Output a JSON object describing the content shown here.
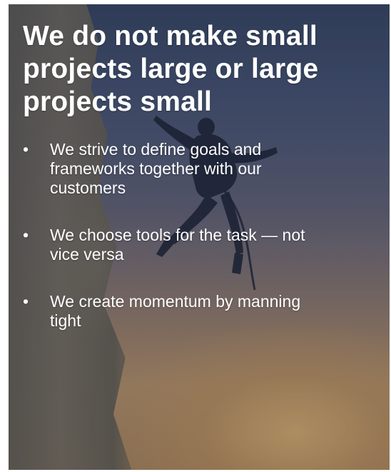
{
  "slide": {
    "headline": "We do not make small projects large or large projects small",
    "bullet_glyph": "•",
    "bullets": [
      "We strive to define goals and frameworks together with our customers",
      "We choose tools for the task — not vice versa",
      "We create momentum by manning tight"
    ]
  },
  "colors": {
    "text": "#ffffff",
    "sky_top": "#3b4b66",
    "sunset_glow": "#c29c6e"
  },
  "icons": {
    "background_image": "rock-climber-silhouette-photo"
  }
}
